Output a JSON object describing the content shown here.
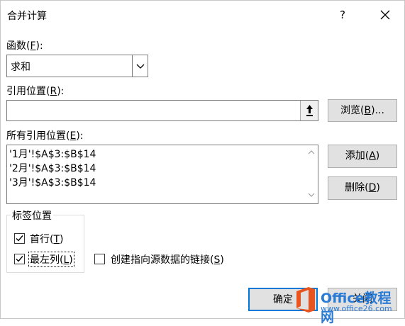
{
  "dialog": {
    "title": "合并计算",
    "help": "?"
  },
  "function": {
    "label_prefix": "函数(",
    "label_key": "F",
    "label_suffix": "):",
    "value": "求和"
  },
  "reference": {
    "label_prefix": "引用位置(",
    "label_key": "R",
    "label_suffix": "):",
    "value": "",
    "browse_prefix": "浏览(",
    "browse_key": "B",
    "browse_suffix": ")..."
  },
  "all_references": {
    "label_prefix": "所有引用位置(",
    "label_key": "E",
    "label_suffix": "):",
    "items": [
      "'1月'!$A$3:$B$14",
      "'2月'!$A$3:$B$14",
      "'3月'!$A$3:$B$14"
    ],
    "add_prefix": "添加(",
    "add_key": "A",
    "add_suffix": ")",
    "delete_prefix": "删除(",
    "delete_key": "D",
    "delete_suffix": ")"
  },
  "labels": {
    "group_title": "标签位置",
    "top_row": {
      "prefix": "首行(",
      "key": "T",
      "suffix": ")",
      "checked": true
    },
    "left_column": {
      "prefix": "最左列(",
      "key": "L",
      "suffix": ")",
      "checked": true
    },
    "link_source": {
      "prefix": "创建指向源数据的链接(",
      "key": "S",
      "suffix": ")",
      "checked": false
    }
  },
  "footer": {
    "ok_label": "确定",
    "close_label": "关闭"
  },
  "watermark": {
    "brand": "Office教程网",
    "url": "www.office26.com"
  },
  "colors": {
    "accent": "#0078d7",
    "watermark_orange": "#e8541e",
    "watermark_blue": "#2a7bd5"
  }
}
